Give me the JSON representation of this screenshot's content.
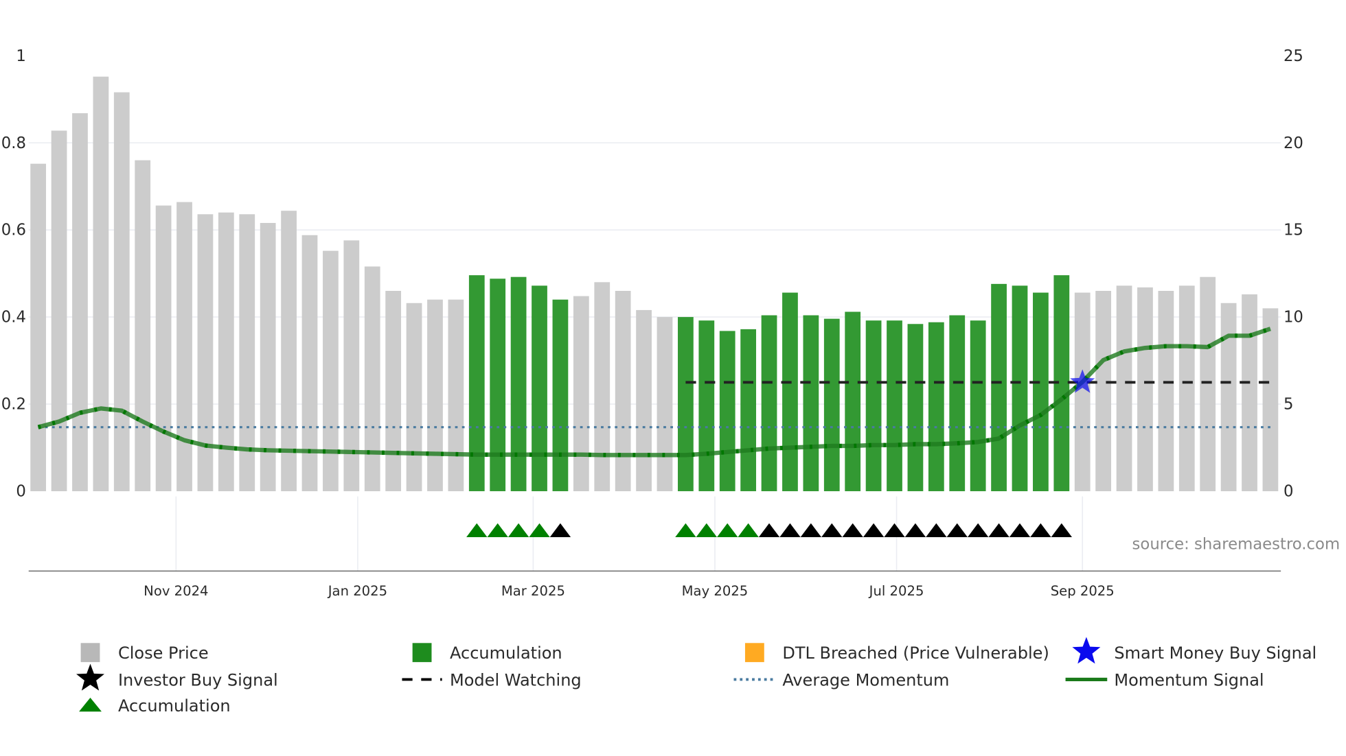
{
  "chart_data": {
    "type": "bar",
    "title": "",
    "source": "source: sharemaestro.com",
    "left_axis": {
      "ylim": [
        0,
        1
      ],
      "ticks": [
        "0",
        "0.2",
        "0.4",
        "0.6",
        "0.8",
        "1"
      ],
      "tick_values": [
        0,
        0.2,
        0.4,
        0.6,
        0.8,
        1
      ]
    },
    "right_axis": {
      "ylim": [
        0,
        25
      ],
      "ticks": [
        "0",
        "5",
        "10",
        "15",
        "20",
        "25"
      ],
      "tick_values": [
        0,
        5,
        10,
        15,
        20,
        25
      ]
    },
    "x_ticks": [
      {
        "label": "Nov 2024",
        "bar_index": 7.6
      },
      {
        "label": "Jan 2025",
        "bar_index": 16.3
      },
      {
        "label": "Mar 2025",
        "bar_index": 24.7
      },
      {
        "label": "May 2025",
        "bar_index": 33.4
      },
      {
        "label": "Jul 2025",
        "bar_index": 42.1
      },
      {
        "label": "Sep 2025",
        "bar_index": 51.0
      }
    ],
    "close_price": [
      18.8,
      20.7,
      21.7,
      23.8,
      22.9,
      19.0,
      16.4,
      16.6,
      15.9,
      16.0,
      15.9,
      15.4,
      16.1,
      14.7,
      13.8,
      14.4,
      12.9,
      11.5,
      10.8,
      11.0,
      11.0,
      12.4,
      12.2,
      12.3,
      11.8,
      11.0,
      11.2,
      12.0,
      11.5,
      10.4,
      10.0,
      10.0,
      9.8,
      9.2,
      9.3,
      10.1,
      11.4,
      10.1,
      9.9,
      10.3,
      9.8,
      9.8,
      9.6,
      9.7,
      10.1,
      9.8,
      11.9,
      11.8,
      11.4,
      12.4,
      11.4,
      11.5,
      11.8,
      11.7,
      11.5,
      11.8,
      12.3,
      10.8,
      11.3,
      10.5
    ],
    "accumulation_bars": [
      false,
      false,
      false,
      false,
      false,
      false,
      false,
      false,
      false,
      false,
      false,
      false,
      false,
      false,
      false,
      false,
      false,
      false,
      false,
      false,
      false,
      true,
      true,
      true,
      true,
      true,
      false,
      false,
      false,
      false,
      false,
      true,
      true,
      true,
      true,
      true,
      true,
      true,
      true,
      true,
      true,
      true,
      true,
      true,
      true,
      true,
      true,
      true,
      true,
      true,
      false,
      false,
      false,
      false,
      false,
      false,
      false,
      false,
      false,
      false
    ],
    "momentum_signal": [
      0.147,
      0.16,
      0.18,
      0.19,
      0.185,
      0.16,
      0.137,
      0.117,
      0.105,
      0.1,
      0.096,
      0.094,
      0.093,
      0.092,
      0.091,
      0.09,
      0.089,
      0.088,
      0.087,
      0.086,
      0.085,
      0.084,
      0.084,
      0.084,
      0.084,
      0.084,
      0.084,
      0.083,
      0.083,
      0.083,
      0.083,
      0.083,
      0.086,
      0.09,
      0.094,
      0.098,
      0.1,
      0.102,
      0.104,
      0.104,
      0.106,
      0.106,
      0.108,
      0.108,
      0.11,
      0.113,
      0.121,
      0.151,
      0.175,
      0.211,
      0.251,
      0.301,
      0.321,
      0.329,
      0.333,
      0.333,
      0.331,
      0.357,
      0.357,
      0.373
    ],
    "average_momentum": 0.147,
    "model_watching": {
      "value": 0.25,
      "from_bar": 32,
      "to_bar": 60
    },
    "smart_money_buy_signal": [
      {
        "bar": 51,
        "value": 0.25
      }
    ],
    "accumulation_markers": [
      22,
      23,
      24,
      25,
      32,
      33,
      34,
      35
    ],
    "investor_buy_markers": [
      26,
      36,
      37,
      38,
      39,
      40,
      41,
      42,
      43,
      44,
      45,
      46,
      47,
      48,
      49,
      50
    ],
    "colors": {
      "close": "#cccccc",
      "accumulation": "#339933",
      "dtl": "#ffaa22",
      "smart_money": "#0a0aee",
      "avg_momentum": "#4a7ba0",
      "momentum": "#1e7a1e"
    },
    "legend": [
      {
        "label": "Close Price",
        "icon": "grey-square"
      },
      {
        "label": "Accumulation",
        "icon": "green-square"
      },
      {
        "label": "DTL Breached (Price Vulnerable)",
        "icon": "orange-square"
      },
      {
        "label": "Smart Money Buy Signal",
        "icon": "blue-star"
      },
      {
        "label": "Investor Buy Signal",
        "icon": "black-star"
      },
      {
        "label": "Model Watching",
        "icon": "black-dash"
      },
      {
        "label": "Average Momentum",
        "icon": "blue-dotted"
      },
      {
        "label": "Momentum Signal",
        "icon": "green-line"
      },
      {
        "label": "Accumulation",
        "icon": "green-triangle"
      }
    ]
  }
}
